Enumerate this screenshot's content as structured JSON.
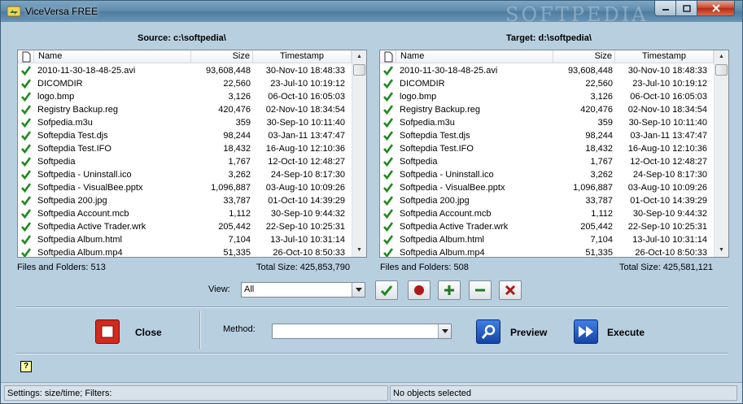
{
  "window": {
    "title": "ViceVersa FREE",
    "watermark": "SOFTPEDIA"
  },
  "columns": {
    "name": "Name",
    "size": "Size",
    "timestamp": "Timestamp"
  },
  "source": {
    "title": "Source:  c:\\softpedia\\",
    "info_count": "Files and Folders: 513",
    "info_size": "Total Size: 425,853,790",
    "rows": [
      {
        "name": "2010-11-30-18-48-25.avi",
        "size": "93,608,448",
        "ts": "30-Nov-10 18:48:33"
      },
      {
        "name": "DICOMDIR",
        "size": "22,560",
        "ts": "23-Jul-10 10:19:12"
      },
      {
        "name": "logo.bmp",
        "size": "3,126",
        "ts": "06-Oct-10 16:05:03"
      },
      {
        "name": "Registry Backup.reg",
        "size": "420,476",
        "ts": "02-Nov-10 18:34:54"
      },
      {
        "name": "Sofpedia.m3u",
        "size": "359",
        "ts": "30-Sep-10 10:11:40"
      },
      {
        "name": "Softepdia Test.djs",
        "size": "98,244",
        "ts": "03-Jan-11 13:47:47"
      },
      {
        "name": "Softepdia Test.IFO",
        "size": "18,432",
        "ts": "16-Aug-10 12:10:36"
      },
      {
        "name": "Softpedia",
        "size": "1,767",
        "ts": "12-Oct-10 12:48:27"
      },
      {
        "name": "Softpedia - Uninstall.ico",
        "size": "3,262",
        "ts": "24-Sep-10 8:17:30"
      },
      {
        "name": "Softpedia - VisualBee.pptx",
        "size": "1,096,887",
        "ts": "03-Aug-10 10:09:26"
      },
      {
        "name": "Softpedia 200.jpg",
        "size": "33,787",
        "ts": "01-Oct-10 14:39:29"
      },
      {
        "name": "Softpedia Account.mcb",
        "size": "1,112",
        "ts": "30-Sep-10 9:44:32"
      },
      {
        "name": "Softpedia Active Trader.wrk",
        "size": "205,442",
        "ts": "22-Sep-10 10:25:31"
      },
      {
        "name": "Softpedia Album.html",
        "size": "7,104",
        "ts": "13-Jul-10 10:31:14"
      },
      {
        "name": "Softpedia Album.mp4",
        "size": "51,335",
        "ts": "26-Oct-10 8:50:33"
      }
    ]
  },
  "target": {
    "title": "Target:  d:\\softpedia\\",
    "info_count": "Files and Folders: 508",
    "info_size": "Total Size: 425,581,121",
    "rows": [
      {
        "name": "2010-11-30-18-48-25.avi",
        "size": "93,608,448",
        "ts": "30-Nov-10 18:48:33"
      },
      {
        "name": "DICOMDIR",
        "size": "22,560",
        "ts": "23-Jul-10 10:19:12"
      },
      {
        "name": "logo.bmp",
        "size": "3,126",
        "ts": "06-Oct-10 16:05:03"
      },
      {
        "name": "Registry Backup.reg",
        "size": "420,476",
        "ts": "02-Nov-10 18:34:54"
      },
      {
        "name": "Sofpedia.m3u",
        "size": "359",
        "ts": "30-Sep-10 10:11:40"
      },
      {
        "name": "Softepdia Test.djs",
        "size": "98,244",
        "ts": "03-Jan-11 13:47:47"
      },
      {
        "name": "Softepdia Test.IFO",
        "size": "18,432",
        "ts": "16-Aug-10 12:10:36"
      },
      {
        "name": "Softpedia",
        "size": "1,767",
        "ts": "12-Oct-10 12:48:27"
      },
      {
        "name": "Softpedia - Uninstall.ico",
        "size": "3,262",
        "ts": "24-Sep-10 8:17:30"
      },
      {
        "name": "Softpedia - VisualBee.pptx",
        "size": "1,096,887",
        "ts": "03-Aug-10 10:09:26"
      },
      {
        "name": "Softpedia 200.jpg",
        "size": "33,787",
        "ts": "01-Oct-10 14:39:29"
      },
      {
        "name": "Softpedia Account.mcb",
        "size": "1,112",
        "ts": "30-Sep-10 9:44:32"
      },
      {
        "name": "Softpedia Active Trader.wrk",
        "size": "205,442",
        "ts": "22-Sep-10 10:25:31"
      },
      {
        "name": "Softpedia Album.html",
        "size": "7,104",
        "ts": "13-Jul-10 10:31:14"
      },
      {
        "name": "Softpedia Album.mp4",
        "size": "51,335",
        "ts": "26-Oct-10 8:50:33"
      }
    ]
  },
  "view": {
    "label": "View:",
    "value": "All"
  },
  "actions": {
    "close_label": "Close",
    "method_label": "Method:",
    "method_value": "",
    "preview_label": "Preview",
    "execute_label": "Execute"
  },
  "status": {
    "left": "Settings: size/time; Filters:",
    "right": "No objects selected"
  },
  "icons": {
    "check": "check-icon",
    "doc": "document-icon",
    "help": "help-icon",
    "help_glyph": "?"
  },
  "colors": {
    "check_green": "#1f8a1f",
    "close_red": "#d22a1e",
    "preview_blue": "#1a56c4"
  }
}
